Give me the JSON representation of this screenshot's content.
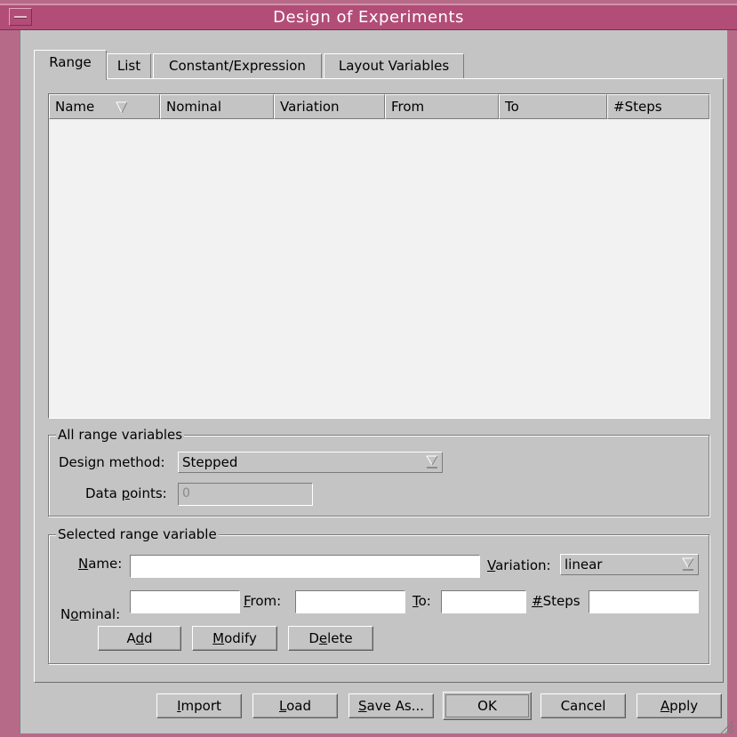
{
  "window": {
    "title": "Design of Experiments"
  },
  "tabs": [
    {
      "label": "Range",
      "active": true
    },
    {
      "label": "List"
    },
    {
      "label": "Constant/Expression"
    },
    {
      "label": "Layout Variables"
    }
  ],
  "table": {
    "columns": [
      "Name",
      "Nominal",
      "Variation",
      "From",
      "To",
      "#Steps"
    ],
    "rows": []
  },
  "all_range": {
    "group_label": "All range variables",
    "design_method_label_pre": "Desi",
    "design_method_label_mn": "g",
    "design_method_label_post": "n method:",
    "design_method_value": "Stepped",
    "data_points_label_pre": "Data ",
    "data_points_label_mn": "p",
    "data_points_label_post": "oints:",
    "data_points_value": "0"
  },
  "selected": {
    "group_label": "Selected range variable",
    "name_label_mn": "N",
    "name_label_post": "ame:",
    "name_value": "",
    "variation_label_mn": "V",
    "variation_label_post": "ariation:",
    "variation_value": "linear",
    "nominal_label_pre": "N",
    "nominal_label_mn": "o",
    "nominal_label_post": "minal:",
    "nominal_value": "",
    "from_label_mn": "F",
    "from_label_post": "rom:",
    "from_value": "",
    "to_label_mn": "T",
    "to_label_post": "o:",
    "to_value": "",
    "steps_label_mn": "#",
    "steps_label_post": "Steps",
    "steps_value": "",
    "add_pre": "A",
    "add_mn": "d",
    "add_post": "d",
    "modify_mn": "M",
    "modify_post": "odify",
    "delete_pre": "D",
    "delete_mn": "e",
    "delete_post": "lete"
  },
  "footer": {
    "import_mn": "I",
    "import_post": "mport",
    "load_mn": "L",
    "load_post": "oad",
    "saveas_mn": "S",
    "saveas_post": "ave As...",
    "ok": "OK",
    "cancel": "Cancel",
    "apply_mn": "A",
    "apply_post": "pply"
  },
  "colors": {
    "titlebar": "#b24d77",
    "panel": "#c4c4c4",
    "table_bg": "#f2f2f2"
  }
}
